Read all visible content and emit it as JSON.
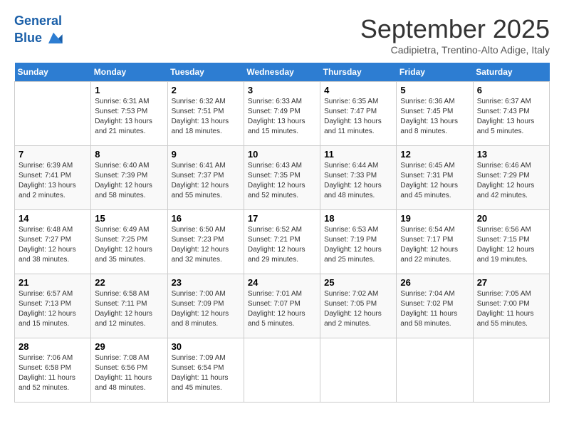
{
  "header": {
    "logo_line1": "General",
    "logo_line2": "Blue",
    "month": "September 2025",
    "location": "Cadipietra, Trentino-Alto Adige, Italy"
  },
  "weekdays": [
    "Sunday",
    "Monday",
    "Tuesday",
    "Wednesday",
    "Thursday",
    "Friday",
    "Saturday"
  ],
  "weeks": [
    [
      {
        "day": null
      },
      {
        "day": "1",
        "sunrise": "6:31 AM",
        "sunset": "7:53 PM",
        "daylight": "13 hours and 21 minutes."
      },
      {
        "day": "2",
        "sunrise": "6:32 AM",
        "sunset": "7:51 PM",
        "daylight": "13 hours and 18 minutes."
      },
      {
        "day": "3",
        "sunrise": "6:33 AM",
        "sunset": "7:49 PM",
        "daylight": "13 hours and 15 minutes."
      },
      {
        "day": "4",
        "sunrise": "6:35 AM",
        "sunset": "7:47 PM",
        "daylight": "13 hours and 11 minutes."
      },
      {
        "day": "5",
        "sunrise": "6:36 AM",
        "sunset": "7:45 PM",
        "daylight": "13 hours and 8 minutes."
      },
      {
        "day": "6",
        "sunrise": "6:37 AM",
        "sunset": "7:43 PM",
        "daylight": "13 hours and 5 minutes."
      }
    ],
    [
      {
        "day": "7",
        "sunrise": "6:39 AM",
        "sunset": "7:41 PM",
        "daylight": "13 hours and 2 minutes."
      },
      {
        "day": "8",
        "sunrise": "6:40 AM",
        "sunset": "7:39 PM",
        "daylight": "12 hours and 58 minutes."
      },
      {
        "day": "9",
        "sunrise": "6:41 AM",
        "sunset": "7:37 PM",
        "daylight": "12 hours and 55 minutes."
      },
      {
        "day": "10",
        "sunrise": "6:43 AM",
        "sunset": "7:35 PM",
        "daylight": "12 hours and 52 minutes."
      },
      {
        "day": "11",
        "sunrise": "6:44 AM",
        "sunset": "7:33 PM",
        "daylight": "12 hours and 48 minutes."
      },
      {
        "day": "12",
        "sunrise": "6:45 AM",
        "sunset": "7:31 PM",
        "daylight": "12 hours and 45 minutes."
      },
      {
        "day": "13",
        "sunrise": "6:46 AM",
        "sunset": "7:29 PM",
        "daylight": "12 hours and 42 minutes."
      }
    ],
    [
      {
        "day": "14",
        "sunrise": "6:48 AM",
        "sunset": "7:27 PM",
        "daylight": "12 hours and 38 minutes."
      },
      {
        "day": "15",
        "sunrise": "6:49 AM",
        "sunset": "7:25 PM",
        "daylight": "12 hours and 35 minutes."
      },
      {
        "day": "16",
        "sunrise": "6:50 AM",
        "sunset": "7:23 PM",
        "daylight": "12 hours and 32 minutes."
      },
      {
        "day": "17",
        "sunrise": "6:52 AM",
        "sunset": "7:21 PM",
        "daylight": "12 hours and 29 minutes."
      },
      {
        "day": "18",
        "sunrise": "6:53 AM",
        "sunset": "7:19 PM",
        "daylight": "12 hours and 25 minutes."
      },
      {
        "day": "19",
        "sunrise": "6:54 AM",
        "sunset": "7:17 PM",
        "daylight": "12 hours and 22 minutes."
      },
      {
        "day": "20",
        "sunrise": "6:56 AM",
        "sunset": "7:15 PM",
        "daylight": "12 hours and 19 minutes."
      }
    ],
    [
      {
        "day": "21",
        "sunrise": "6:57 AM",
        "sunset": "7:13 PM",
        "daylight": "12 hours and 15 minutes."
      },
      {
        "day": "22",
        "sunrise": "6:58 AM",
        "sunset": "7:11 PM",
        "daylight": "12 hours and 12 minutes."
      },
      {
        "day": "23",
        "sunrise": "7:00 AM",
        "sunset": "7:09 PM",
        "daylight": "12 hours and 8 minutes."
      },
      {
        "day": "24",
        "sunrise": "7:01 AM",
        "sunset": "7:07 PM",
        "daylight": "12 hours and 5 minutes."
      },
      {
        "day": "25",
        "sunrise": "7:02 AM",
        "sunset": "7:05 PM",
        "daylight": "12 hours and 2 minutes."
      },
      {
        "day": "26",
        "sunrise": "7:04 AM",
        "sunset": "7:02 PM",
        "daylight": "11 hours and 58 minutes."
      },
      {
        "day": "27",
        "sunrise": "7:05 AM",
        "sunset": "7:00 PM",
        "daylight": "11 hours and 55 minutes."
      }
    ],
    [
      {
        "day": "28",
        "sunrise": "7:06 AM",
        "sunset": "6:58 PM",
        "daylight": "11 hours and 52 minutes."
      },
      {
        "day": "29",
        "sunrise": "7:08 AM",
        "sunset": "6:56 PM",
        "daylight": "11 hours and 48 minutes."
      },
      {
        "day": "30",
        "sunrise": "7:09 AM",
        "sunset": "6:54 PM",
        "daylight": "11 hours and 45 minutes."
      },
      {
        "day": null
      },
      {
        "day": null
      },
      {
        "day": null
      },
      {
        "day": null
      }
    ]
  ]
}
